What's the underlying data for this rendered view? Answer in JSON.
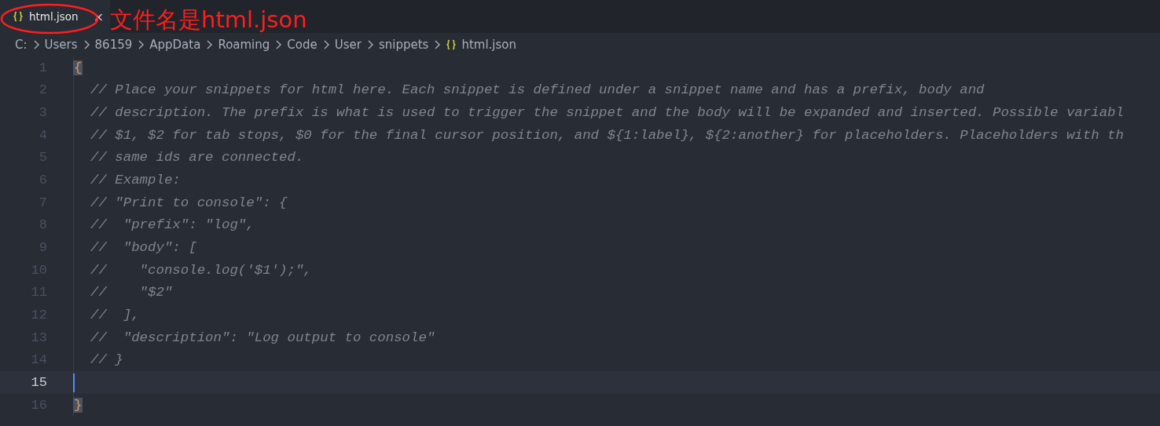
{
  "tabs": [
    {
      "label": "html.json",
      "close": "×",
      "selected": true
    }
  ],
  "annotation": {
    "text": "文件名是html.json"
  },
  "breadcrumb": [
    {
      "label": "C:",
      "kind": "folder"
    },
    {
      "label": "Users",
      "kind": "folder"
    },
    {
      "label": "86159",
      "kind": "folder"
    },
    {
      "label": "AppData",
      "kind": "folder"
    },
    {
      "label": "Roaming",
      "kind": "folder"
    },
    {
      "label": "Code",
      "kind": "folder"
    },
    {
      "label": "User",
      "kind": "folder"
    },
    {
      "label": "snippets",
      "kind": "folder"
    },
    {
      "label": "html.json",
      "kind": "json-file"
    }
  ],
  "editor": {
    "lines": [
      {
        "number": "1",
        "kind": "brace",
        "text": "{",
        "selected": false
      },
      {
        "number": "2",
        "kind": "comment",
        "text": "// Place your snippets for html here. Each snippet is defined under a snippet name and has a prefix, body and",
        "selected": false
      },
      {
        "number": "3",
        "kind": "comment",
        "text": "// description. The prefix is what is used to trigger the snippet and the body will be expanded and inserted. Possible variabl",
        "selected": false
      },
      {
        "number": "4",
        "kind": "comment",
        "text": "// $1, $2 for tab stops, $0 for the final cursor position, and ${1:label}, ${2:another} for placeholders. Placeholders with th",
        "selected": false
      },
      {
        "number": "5",
        "kind": "comment",
        "text": "// same ids are connected.",
        "selected": false
      },
      {
        "number": "6",
        "kind": "comment",
        "text": "// Example:",
        "selected": false
      },
      {
        "number": "7",
        "kind": "comment",
        "text": "// \"Print to console\": {",
        "selected": false
      },
      {
        "number": "8",
        "kind": "comment",
        "text": "//  \"prefix\": \"log\",",
        "selected": false
      },
      {
        "number": "9",
        "kind": "comment",
        "text": "//  \"body\": [",
        "selected": false
      },
      {
        "number": "10",
        "kind": "comment",
        "text": "//    \"console.log('$1');\",",
        "selected": false
      },
      {
        "number": "11",
        "kind": "comment",
        "text": "//    \"$2\"",
        "selected": false
      },
      {
        "number": "12",
        "kind": "comment",
        "text": "//  ],",
        "selected": false
      },
      {
        "number": "13",
        "kind": "comment",
        "text": "//  \"description\": \"Log output to console\"",
        "selected": false
      },
      {
        "number": "14",
        "kind": "comment",
        "text": "// }",
        "selected": false
      },
      {
        "number": "15",
        "kind": "empty",
        "selected": true
      },
      {
        "number": "16",
        "kind": "brace",
        "text": "}",
        "selected": false
      }
    ]
  }
}
